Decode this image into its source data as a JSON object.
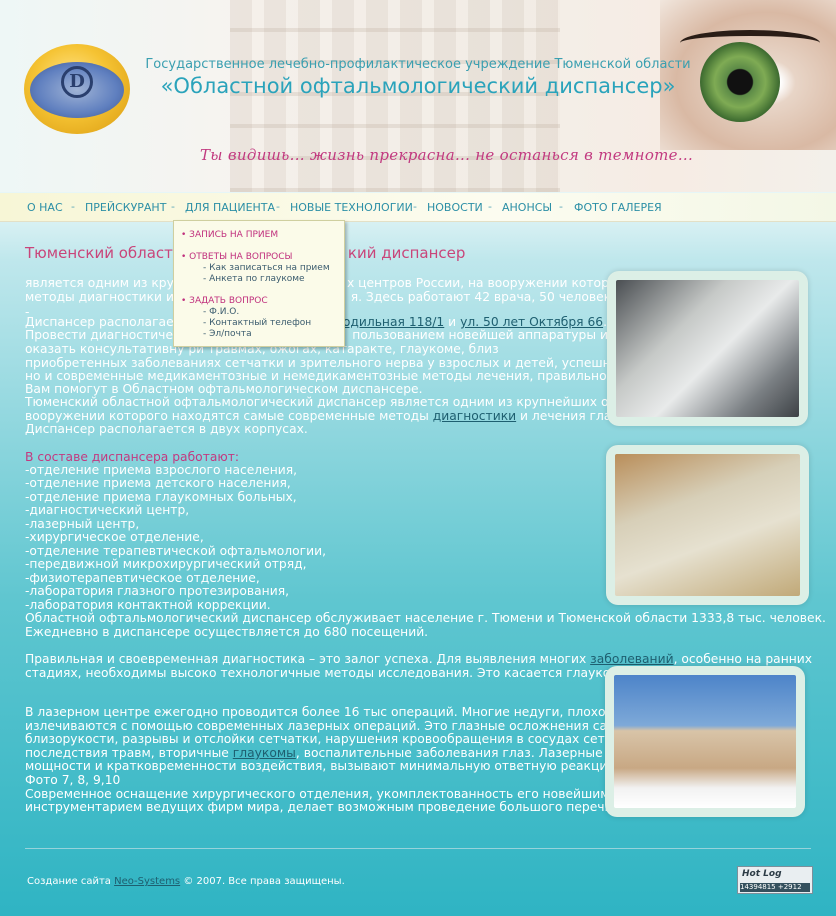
{
  "header": {
    "org_line1": "Государственное лечебно-профилактическое учреждение Тюменской области",
    "org_line2": "«Областной офтальмологический диспансер»",
    "slogan": "Ты видишь...  жизнь прекрасна...  не останься в темноте...",
    "logo_letter": "D"
  },
  "nav": {
    "items": [
      "О НАС",
      "ПРЕЙСКУРАНТ",
      "ДЛЯ ПАЦИЕНТА",
      "НОВЫЕ ТЕХНОЛОГИИ",
      "НОВОСТИ",
      "АНОНСЫ",
      "ФОТО ГАЛЕРЕЯ"
    ],
    "separator": "-"
  },
  "dropdown": {
    "item1": "• ЗАПИСЬ НА ПРИЕМ",
    "item2": "• ОТВЕТЫ НА ВОПРОСЫ",
    "item2_sub1": "- Как записаться на прием",
    "item2_sub2": "- Анкета по глаукоме",
    "item3": "• ЗАДАТЬ ВОПРОС",
    "item3_sub1": "- Ф.И.О.",
    "item3_sub2": "- Контактный телефон",
    "item3_sub3": "- Эл/почта"
  },
  "content": {
    "heading_left": "Тюменский област",
    "heading_right": "кий диспансер",
    "p1_l1a": "является одним из круп",
    "p1_l1b": "х центров России, на вооружении которого",
    "p1_l2a": "методы диагностики и л",
    "p1_l2b": "я.  Здесь работают 42 врача, 50 человек ср",
    "p2_l1a": "-",
    "p2_l2a": "Диспансер располагает",
    "p2_l2_link1": "одильная 118/1",
    "p2_l2_and": " и ",
    "p2_l2_link2": "ул. 50 лет Октября 66",
    "p2_l2_dot": ".",
    "p2_l3a": "Провести диагностическ",
    "p2_l3b": "пользованием новейшей аппаратуры и посл",
    "p2_l4": "оказать консультативну                                       ри травмах, ожогах, катаракте, глаукоме, близ",
    "p2_l5": "приобретенных заболеваниях сетчатки и зрительного нерва у взрослых и детей, успешно прим",
    "p2_l6": "но и современные медикаментозные и немедикаментозные методы лечения,  правильно подобр",
    "p2_l7": "Вам помогут в Областном офтальмологическом диспансере.",
    "p2_l8": "Тюменский областной офтальмологический диспансер является одним из крупнейших офтальм",
    "p2_l9a": "вооружении которого находятся самые современные методы ",
    "p2_l9_link": "диагностики",
    "p2_l9b": " и лечения глазных з",
    "p2_l10": "Диспансер располагается в двух корпусах.",
    "dept_heading": "В составе диспансера работают:",
    "departments": [
      "-отделение приема взрослого населения,",
      "-отделение приема детского населения,",
      "-отделение приема глаукомных больных,",
      "-диагностический центр,",
      "-лазерный центр,",
      "-хирургическое отделение,",
      "-отделение терапевтической офтальмологии,",
      "-передвижной микрохирургический отряд,",
      "-физиотерапевтическое отделение,",
      "-лаборатория глазного протезирования,",
      "-лаборатория контактной коррекции."
    ],
    "p3_l1": "Областной офтальмологический диспансер обслуживает население г. Тюмени и Тюменской области  1333,8 тыс. человек.",
    "p3_l2": "Ежедневно в диспансере осуществляется до 680 посещений.",
    "p4_l1a": "Правильная и своевременная диагностика – это залог успеха. Для выявления многих ",
    "p4_l1_link": "заболеваний",
    "p4_l1b": ", особенно на ранних",
    "p4_l2": "стадиях, необходимы высоко технологичные методы исследования. Это касается глаукомы,  д",
    "p5_l1": "В лазерном центре ежегодно проводится более 16 тыс операций. Многие недуги, плохо подда",
    "p5_l2": "излечиваются с помощью современных лазерных операций. Это глазные осложнения сахарно",
    "p5_l3": "близорукости, разрывы и отслойки сетчатки, нарушения кровообращения в сосудах сетчатки,",
    "p5_l4a": "последствия травм, вторичные ",
    "p5_l4_link": "глаукомы",
    "p5_l4b": ", воспалительные заболевания глаз. Лазерные вмеша",
    "p5_l5": "мощности и кратковременности воздействия, вызывают минимальную ответную реакцию со ст",
    "p5_l6": "Фото 7, 8, 9,10",
    "p6_l1": "Современное оснащение хирургического отделения, укомплектованность его новейшим медиц",
    "p6_l2": "инструментарием ведущих фирм мира, делает возможным проведение большого перечня офта"
  },
  "footer": {
    "prefix": "Создание сайта ",
    "link": "Neo-Systems",
    "suffix": " © 2007. Все права защищены.",
    "counter_title": "Hot Log",
    "counter_numbers": "14394815    +2912"
  }
}
